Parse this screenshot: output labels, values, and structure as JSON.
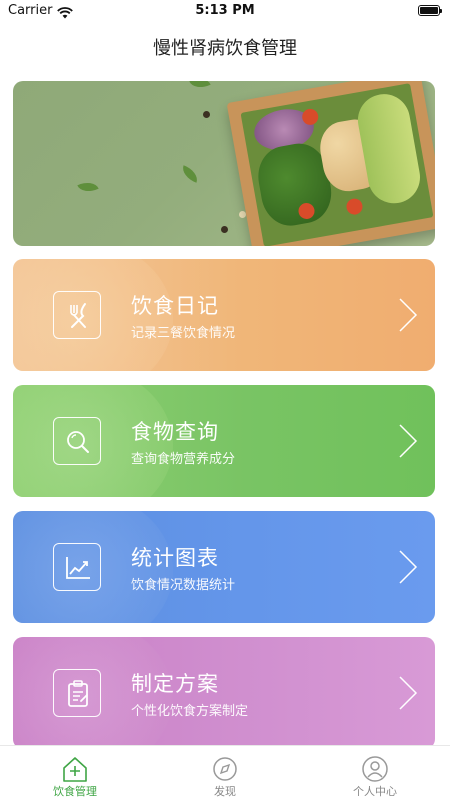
{
  "status_bar": {
    "carrier": "Carrier",
    "time": "5:13 PM"
  },
  "nav": {
    "title": "慢性肾病饮食管理"
  },
  "menu": [
    {
      "title": "饮食日记",
      "subtitle": "记录三餐饮食情况",
      "icon": "fork-knife-icon",
      "color": "#f0b678"
    },
    {
      "title": "食物查询",
      "subtitle": "查询食物营养成分",
      "icon": "search-icon",
      "color": "#79c464"
    },
    {
      "title": "统计图表",
      "subtitle": "饮食情况数据统计",
      "icon": "line-chart-icon",
      "color": "#6496ea"
    },
    {
      "title": "制定方案",
      "subtitle": "个性化饮食方案制定",
      "icon": "clipboard-icon",
      "color": "#d08fcf"
    }
  ],
  "tabbar": {
    "items": [
      {
        "label": "饮食管理",
        "icon": "home-plus-icon",
        "active": true
      },
      {
        "label": "发现",
        "icon": "compass-icon",
        "active": false
      },
      {
        "label": "个人中心",
        "icon": "profile-icon",
        "active": false
      }
    ],
    "active_color": "#3fa545"
  }
}
